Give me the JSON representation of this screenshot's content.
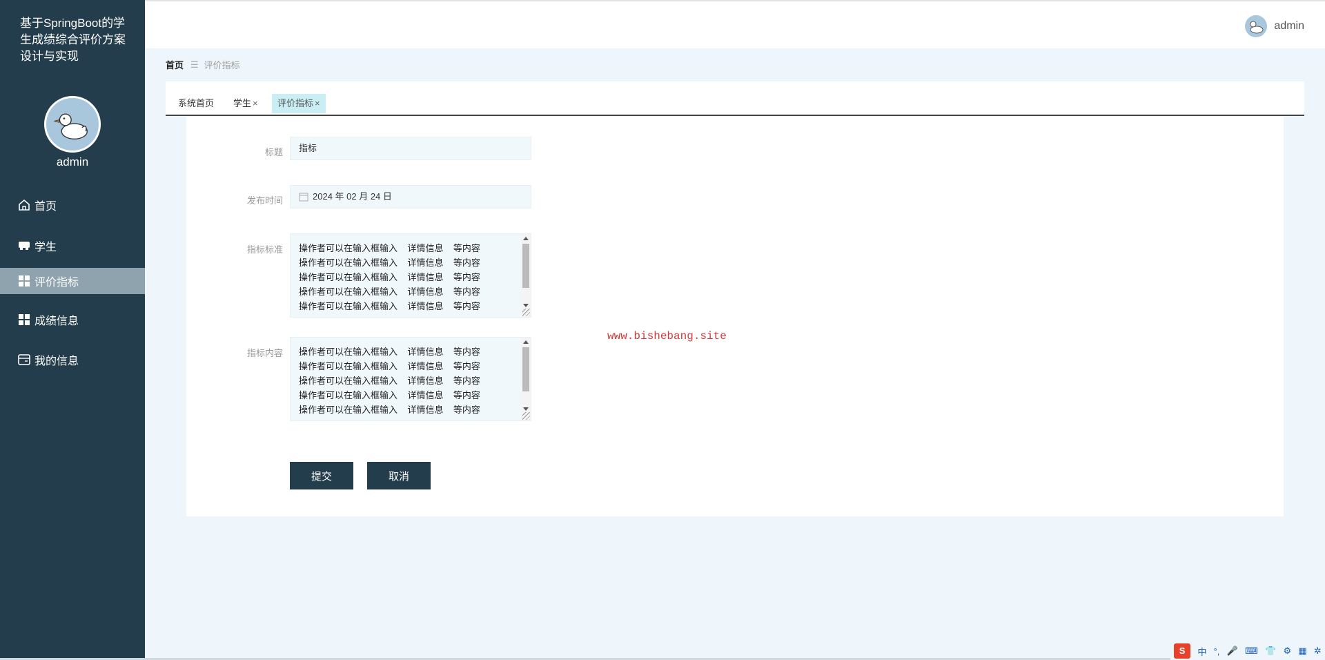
{
  "app": {
    "title": "基于SpringBoot的学生成绩综合评价方案设计与实现",
    "user": "admin"
  },
  "sidebar": {
    "username": "admin",
    "items": [
      {
        "label": "首页",
        "icon": "home-icon",
        "active": false
      },
      {
        "label": "学生",
        "icon": "student-icon",
        "active": false
      },
      {
        "label": "评价指标",
        "icon": "grid-icon",
        "active": true
      },
      {
        "label": "成绩信息",
        "icon": "grid-icon",
        "active": false
      },
      {
        "label": "我的信息",
        "icon": "card-icon",
        "active": false
      }
    ]
  },
  "header": {
    "username": "admin"
  },
  "breadcrumb": {
    "home": "首页",
    "separator": "☰",
    "current": "评价指标"
  },
  "tabs": [
    {
      "label": "系统首页",
      "closable": false,
      "active": false
    },
    {
      "label": "学生",
      "closable": true,
      "active": false
    },
    {
      "label": "评价指标",
      "closable": true,
      "active": true
    }
  ],
  "tab_close_glyph": "×",
  "form": {
    "title_label": "标题",
    "title_value": "指标",
    "date_label": "发布时间",
    "date_value": "2024 年 02 月 24 日",
    "standard_label": "指标标准",
    "standard_lines": [
      "操作者可以在输入框输入    详情信息    等内容",
      "操作者可以在输入框输入    详情信息    等内容",
      "操作者可以在输入框输入    详情信息    等内容",
      "操作者可以在输入框输入    详情信息    等内容",
      "操作者可以在输入框输入    详情信息    等内容"
    ],
    "content_label": "指标内容",
    "content_lines": [
      "操作者可以在输入框输入    详情信息    等内容",
      "操作者可以在输入框输入    详情信息    等内容",
      "操作者可以在输入框输入    详情信息    等内容",
      "操作者可以在输入框输入    详情信息    等内容",
      "操作者可以在输入框输入    详情信息    等内容"
    ],
    "submit_label": "提交",
    "cancel_label": "取消"
  },
  "watermark": "www.bishebang.site",
  "tray": {
    "ime": "S",
    "lang": "中",
    "items": [
      "°,",
      "🎤",
      "⌨",
      "👕",
      "⚙",
      "▦",
      "✲"
    ]
  },
  "colors": {
    "sidebar": "#243d4c",
    "active_menu": "#8fa3ae",
    "active_tab": "#c9eef3",
    "button": "#243d4c",
    "watermark": "#d13a3a"
  }
}
